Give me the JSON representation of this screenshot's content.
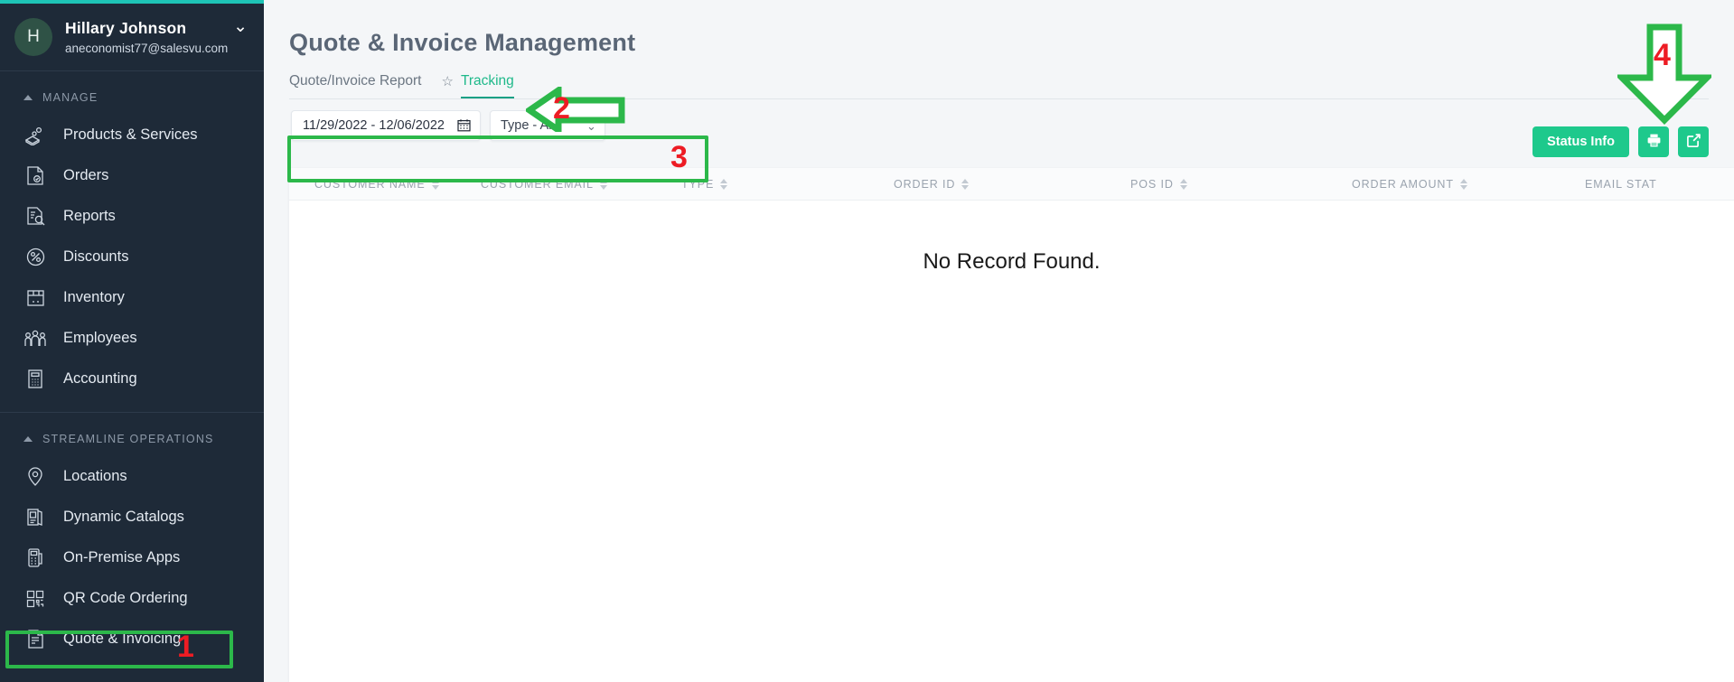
{
  "sidebar": {
    "profile": {
      "initial": "H",
      "name": "Hillary Johnson",
      "email": "aneconomist77@salesvu.com",
      "chevron": "chevron-down"
    },
    "sections": [
      {
        "title": "MANAGE",
        "items": [
          {
            "label": "Products & Services",
            "icon": "products-services-icon"
          },
          {
            "label": "Orders",
            "icon": "orders-icon"
          },
          {
            "label": "Reports",
            "icon": "reports-icon"
          },
          {
            "label": "Discounts",
            "icon": "discounts-icon"
          },
          {
            "label": "Inventory",
            "icon": "inventory-icon"
          },
          {
            "label": "Employees",
            "icon": "employees-icon"
          },
          {
            "label": "Accounting",
            "icon": "accounting-icon"
          }
        ]
      },
      {
        "title": "STREAMLINE OPERATIONS",
        "items": [
          {
            "label": "Locations",
            "icon": "location-pin-icon"
          },
          {
            "label": "Dynamic Catalogs",
            "icon": "catalog-icon"
          },
          {
            "label": "On-Premise Apps",
            "icon": "pos-terminal-icon"
          },
          {
            "label": "QR Code Ordering",
            "icon": "qr-code-icon"
          },
          {
            "label": "Quote & Invoicing",
            "icon": "invoice-document-icon"
          }
        ]
      }
    ]
  },
  "main": {
    "page_title": "Quote & Invoice Management",
    "tabs": [
      {
        "label": "Quote/Invoice Report",
        "active": false,
        "starred": false
      },
      {
        "label": "Tracking",
        "active": true,
        "starred": true
      }
    ],
    "filters": {
      "date_range": "11/29/2022 - 12/06/2022",
      "calendar_icon": "calendar-icon",
      "type_select": "Type - All",
      "type_chevron": "chevron-down-icon"
    },
    "actions": {
      "status_info_label": "Status Info",
      "print_icon": "printer-icon",
      "export_icon": "export-share-icon"
    },
    "table": {
      "columns": [
        "CUSTOMER NAME",
        "CUSTOMER EMAIL",
        "TYPE",
        "ORDER ID",
        "POS ID",
        "ORDER AMOUNT",
        "EMAIL STAT"
      ],
      "rows": [],
      "empty_message": "No Record Found."
    }
  },
  "annotations": [
    {
      "number": "1",
      "kind": "box",
      "target": "sidebar-item-quote-invoicing"
    },
    {
      "number": "2",
      "kind": "arrow",
      "target": "tab-tracking"
    },
    {
      "number": "3",
      "kind": "box",
      "target": "filter-bar"
    },
    {
      "number": "4",
      "kind": "arrow",
      "target": "toolbar-actions"
    }
  ],
  "colors": {
    "sidebar_bg": "#1e2a38",
    "accent_teal": "#1ec4b6",
    "accent_green": "#1ec98c",
    "annotation_green": "#2cb84a",
    "annotation_red": "#ed1c24"
  }
}
